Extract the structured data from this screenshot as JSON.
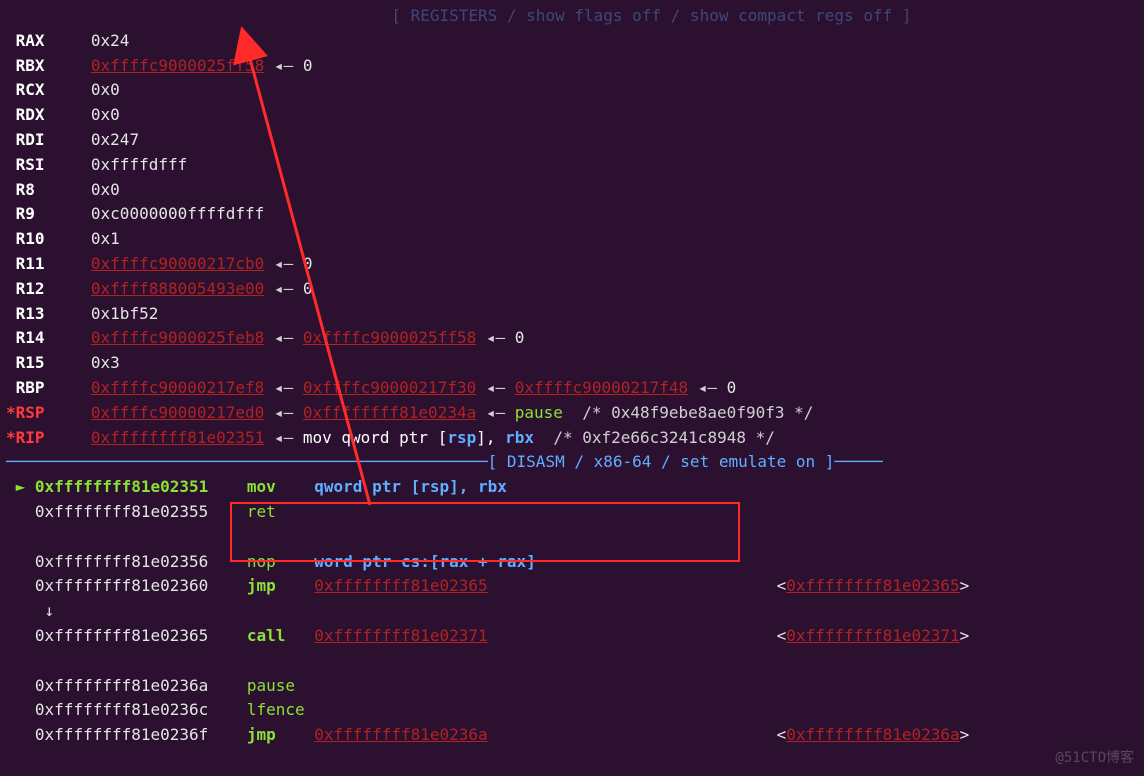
{
  "header_partial": "[ REGISTERS / show flags off / show compact regs off ]",
  "registers": [
    {
      "name": "RAX",
      "changed": false,
      "chain": [
        {
          "v": "0x24",
          "link": false
        }
      ]
    },
    {
      "name": "RBX",
      "changed": false,
      "chain": [
        {
          "v": "0xffffc9000025ff58",
          "link": true
        },
        {
          "v": "0",
          "link": false
        }
      ]
    },
    {
      "name": "RCX",
      "changed": false,
      "chain": [
        {
          "v": "0x0",
          "link": false
        }
      ]
    },
    {
      "name": "RDX",
      "changed": false,
      "chain": [
        {
          "v": "0x0",
          "link": false
        }
      ]
    },
    {
      "name": "RDI",
      "changed": false,
      "chain": [
        {
          "v": "0x247",
          "link": false
        }
      ]
    },
    {
      "name": "RSI",
      "changed": false,
      "chain": [
        {
          "v": "0xffffdfff",
          "link": false
        }
      ]
    },
    {
      "name": "R8",
      "changed": false,
      "chain": [
        {
          "v": "0x0",
          "link": false
        }
      ]
    },
    {
      "name": "R9",
      "changed": false,
      "chain": [
        {
          "v": "0xc0000000ffffdfff",
          "link": false
        }
      ]
    },
    {
      "name": "R10",
      "changed": false,
      "chain": [
        {
          "v": "0x1",
          "link": false
        }
      ]
    },
    {
      "name": "R11",
      "changed": false,
      "chain": [
        {
          "v": "0xffffc90000217cb0",
          "link": true
        },
        {
          "v": "0",
          "link": false
        }
      ]
    },
    {
      "name": "R12",
      "changed": false,
      "chain": [
        {
          "v": "0xffff888005493e00",
          "link": true
        },
        {
          "v": "0",
          "link": false
        }
      ]
    },
    {
      "name": "R13",
      "changed": false,
      "chain": [
        {
          "v": "0x1bf52",
          "link": false
        }
      ]
    },
    {
      "name": "R14",
      "changed": false,
      "chain": [
        {
          "v": "0xffffc9000025feb8",
          "link": true
        },
        {
          "v": "0xffffc9000025ff58",
          "link": true
        },
        {
          "v": "0",
          "link": false
        }
      ]
    },
    {
      "name": "R15",
      "changed": false,
      "chain": [
        {
          "v": "0x3",
          "link": false
        }
      ]
    },
    {
      "name": "RBP",
      "changed": false,
      "chain": [
        {
          "v": "0xffffc90000217ef8",
          "link": true
        },
        {
          "v": "0xffffc90000217f30",
          "link": true
        },
        {
          "v": "0xffffc90000217f48",
          "link": true
        },
        {
          "v": "0",
          "link": false
        }
      ]
    },
    {
      "name": "RSP",
      "changed": true,
      "chain": [
        {
          "v": "0xffffc90000217ed0",
          "link": true
        },
        {
          "v": "0xffffffff81e0234a",
          "link": true
        }
      ],
      "tail_instr": {
        "mnem": "pause",
        "comment": "/* 0x48f9ebe8ae0f90f3 */"
      }
    },
    {
      "name": "RIP",
      "changed": true,
      "chain": [
        {
          "v": "0xffffffff81e02351",
          "link": true
        }
      ],
      "tail_instr": {
        "raw": "mov qword ptr [rsp], rbx",
        "comment": "/* 0xf2e66c3241c8948 */"
      }
    }
  ],
  "disasm_header": "[ DISASM / x86-64 / set emulate on ]",
  "disasm": [
    {
      "addr": "0xffffffff81e02351",
      "current": true,
      "mnem": "mov",
      "bold": true,
      "op_blue": "qword ptr [rsp], rbx"
    },
    {
      "addr": "0xffffffff81e02355",
      "current": false,
      "mnem": "ret",
      "bold": false
    },
    {
      "blank": true
    },
    {
      "addr": "0xffffffff81e02356",
      "current": false,
      "mnem": "nop",
      "bold": false,
      "op_blue": "word ptr cs:[rax + rax]"
    },
    {
      "addr": "0xffffffff81e02360",
      "current": false,
      "mnem": "jmp",
      "bold": true,
      "op_link": "0xffffffff81e02365",
      "target": "0xffffffff81e02365"
    },
    {
      "down_arrow": true
    },
    {
      "addr": "0xffffffff81e02365",
      "current": false,
      "mnem": "call",
      "bold": true,
      "op_link": "0xffffffff81e02371",
      "target": "0xffffffff81e02371"
    },
    {
      "blank": true
    },
    {
      "addr": "0xffffffff81e0236a",
      "current": false,
      "mnem": "pause",
      "bold": false
    },
    {
      "addr": "0xffffffff81e0236c",
      "current": false,
      "mnem": "lfence",
      "bold": false
    },
    {
      "addr": "0xffffffff81e0236f",
      "current": false,
      "mnem": "jmp",
      "bold": true,
      "op_link": "0xffffffff81e0236a",
      "target": "0xffffffff81e0236a"
    }
  ],
  "watermark": "@51CTO博客"
}
